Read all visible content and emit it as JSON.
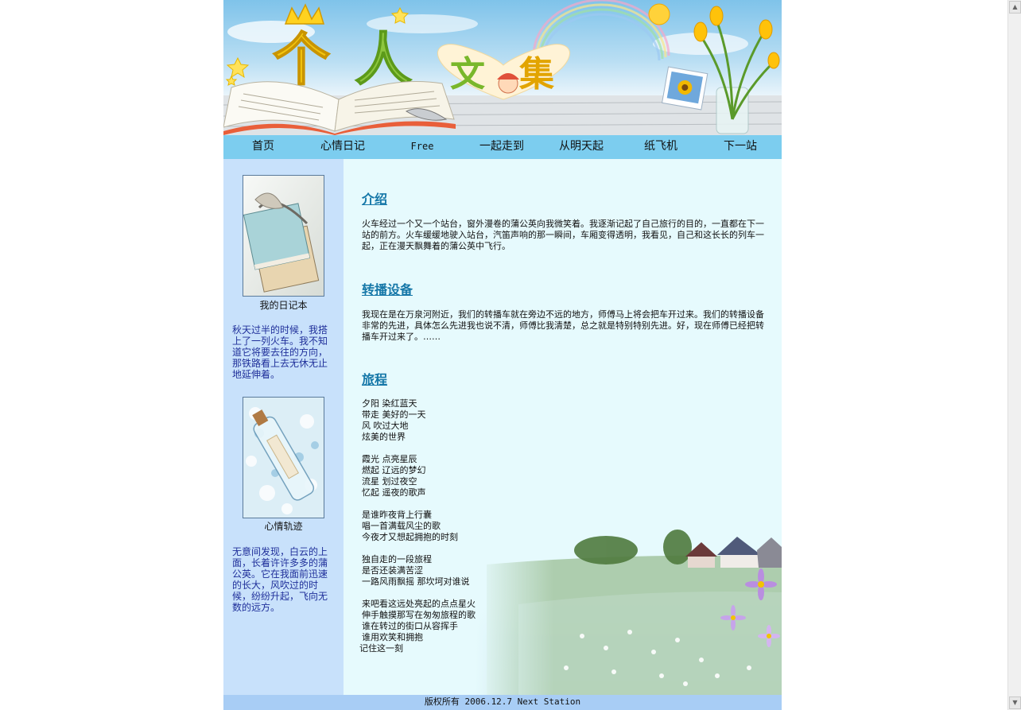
{
  "banner": {
    "title_chars": [
      "个",
      "人"
    ],
    "subtitle_chars": [
      "文",
      "集"
    ]
  },
  "nav": {
    "items": [
      "首页",
      "心情日记",
      "Free",
      "一起走到",
      "从明天起",
      "纸飞机",
      "下一站"
    ]
  },
  "sidebar": {
    "diary_caption": "我的日记本",
    "diary_text": "秋天过半的时候，我搭上了一列火车。我不知道它将要去往的方向，那铁路看上去无休无止地延伸着。",
    "mood_caption": "心情轨迹",
    "mood_text": "无意间发现，白云的上面，长着许许多多的蒲公英。它在我面前迅速的长大，风吹过的时候，纷纷升起，飞向无数的远方。"
  },
  "main": {
    "sections": [
      {
        "title": "介绍",
        "text": "火车经过一个又一个站台，窗外漫卷的蒲公英向我微笑着。我逐渐记起了自己旅行的目的，一直都在下一站的前方。火车缓缓地驶入站台，汽笛声响的那一瞬间，车厢变得透明，我看见，自己和这长长的列车一起，正在漫天飘舞着的蒲公英中飞行。"
      },
      {
        "title": "转播设备",
        "text": "我现在是在万泉河附近，我们的转播车就在旁边不远的地方，师傅马上将会把车开过来。我们的转播设备非常的先进，具体怎么先进我也说不清，师傅比我清楚，总之就是特别特别先进。好，现在师傅已经把转播车开过来了。……"
      },
      {
        "title": "旅程",
        "stanzas": [
          [
            "夕阳 染红蓝天",
            "带走 美好的一天",
            "风 吹过大地",
            "炫美的世界"
          ],
          [
            "霞光 点亮星辰",
            "燃起 辽远的梦幻",
            "流星 划过夜空",
            "忆起 遥夜的歌声"
          ],
          [
            "是谁昨夜背上行囊",
            "唱一首满载风尘的歌",
            "今夜才又想起拥抱的时刻"
          ],
          [
            "独自走的一段旅程",
            "是否还装满苦涩",
            "一路风雨飘摇 那坎坷对谁说"
          ],
          [
            "来吧看这远处亮起的点点星火",
            "伸手触摸那写在匆匆旅程的歌",
            "谁在转过的街口从容挥手",
            "谁用欢笑和拥抱",
            "记住这一刻"
          ]
        ]
      }
    ]
  },
  "footer": {
    "text": "版权所有 2006.12.7 Next Station"
  },
  "colors": {
    "nav_bg": "#7ccdef",
    "sidebar_bg": "#c8e1fb",
    "main_bg": "#e6fafd",
    "footer_bg": "#a8cdf5",
    "heading": "#1577a8",
    "sidebar_text": "#1f2f9a"
  }
}
